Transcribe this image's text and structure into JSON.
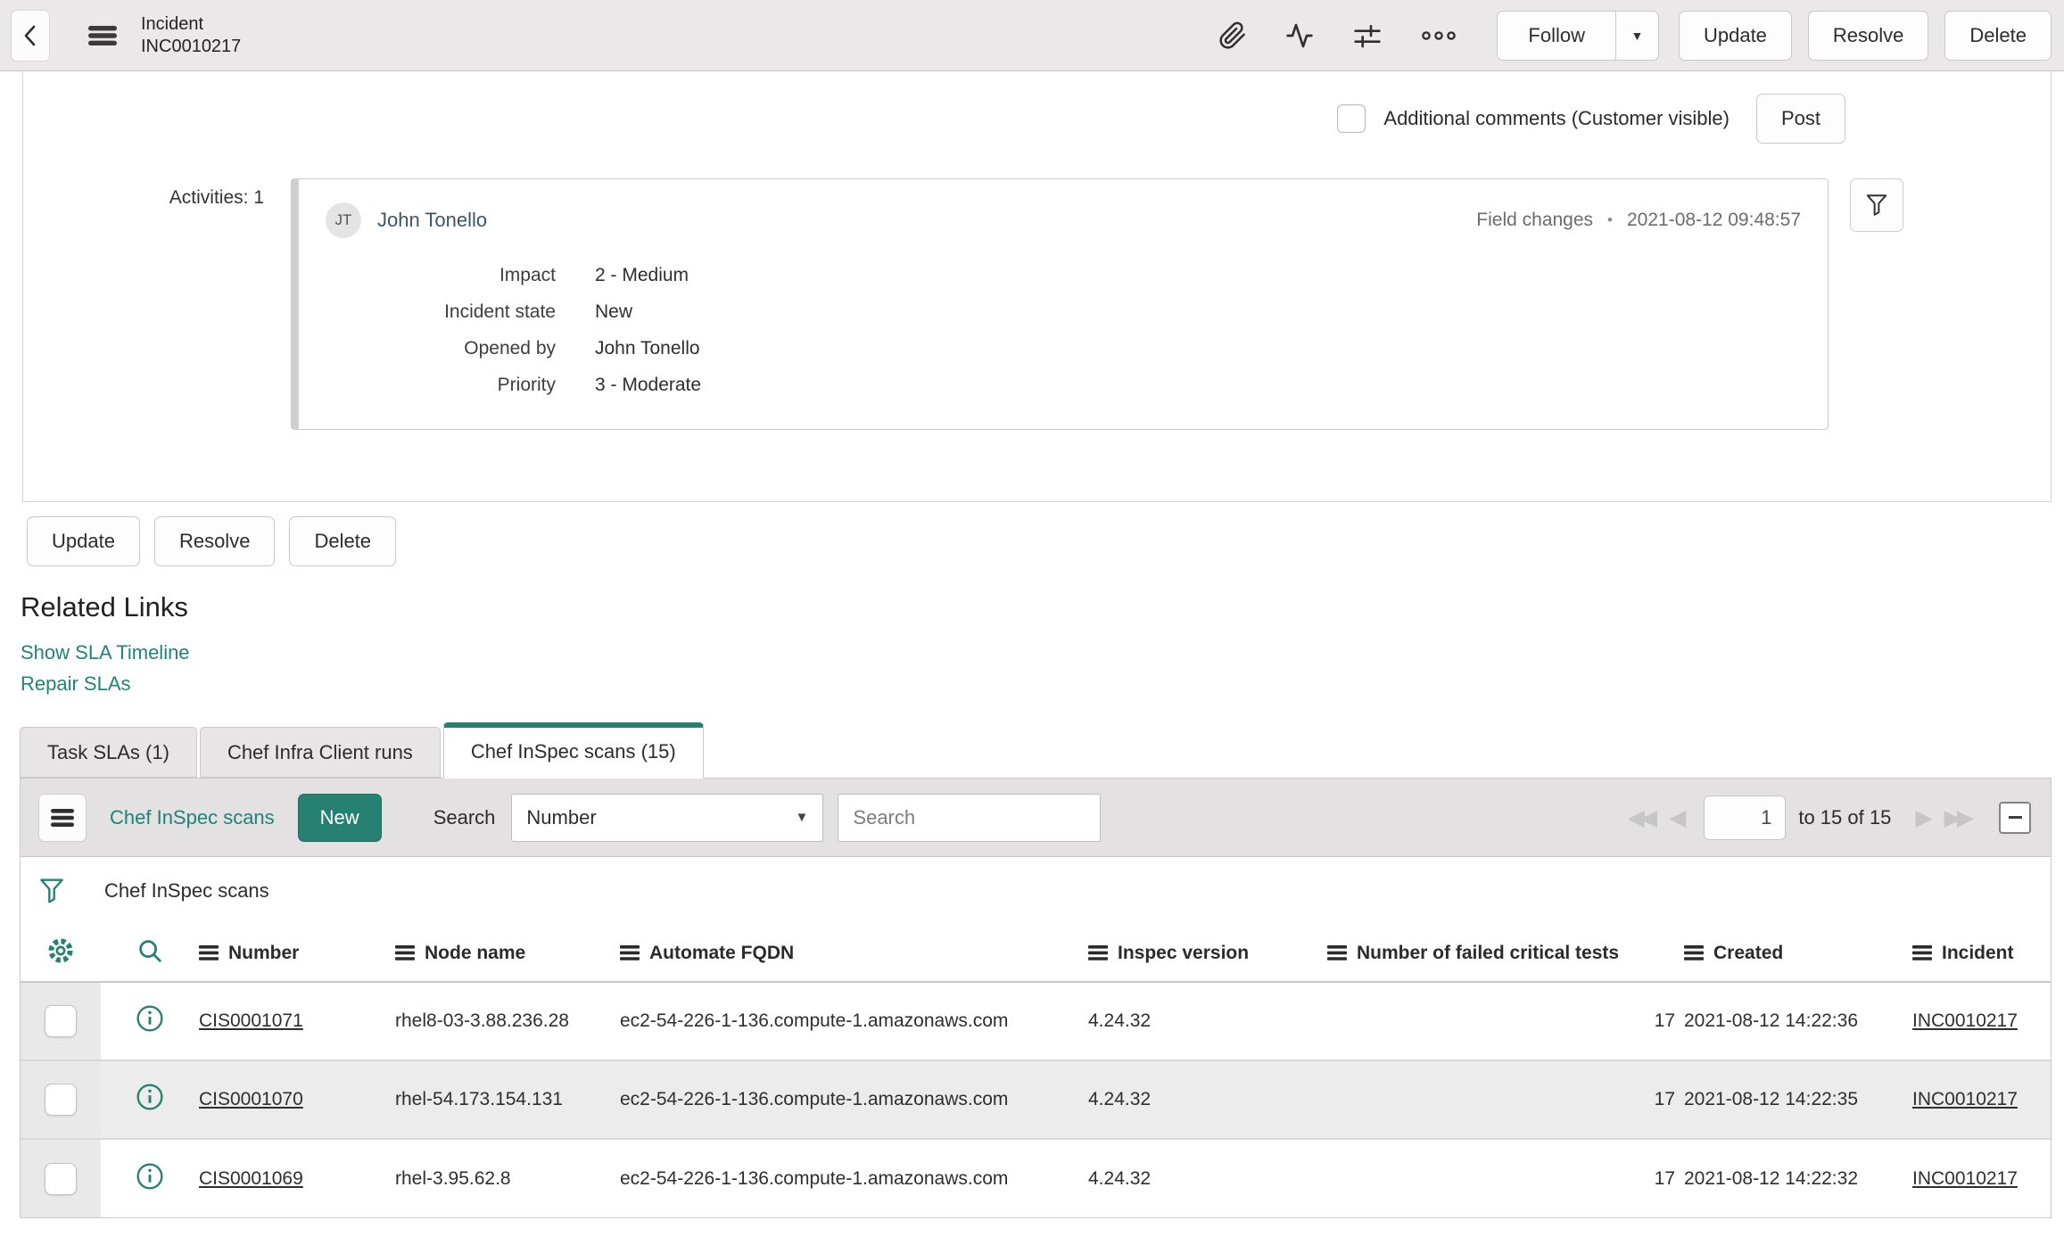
{
  "colors": {
    "accent_teal": "#278172",
    "link_teal": "#1f8476",
    "header_bg": "#eae8e8",
    "toolbar_bg": "#e3e1e1",
    "row_stripe": "#ececec"
  },
  "icons": {
    "caret_down": "▼",
    "first_page": "◀◀",
    "prev_page": "◀",
    "next_page": "▶",
    "last_page": "▶▶"
  },
  "header": {
    "title_line1": "Incident",
    "title_line2": "INC0010217"
  },
  "actions": {
    "follow": "Follow",
    "update": "Update",
    "resolve": "Resolve",
    "delete": "Delete"
  },
  "comment": {
    "checkbox_label": "Additional comments (Customer visible)",
    "post": "Post"
  },
  "activity": {
    "section_label": "Activities: 1",
    "avatar_initials": "JT",
    "user_name": "John Tonello",
    "entry_type": "Field changes",
    "separator": "•",
    "timestamp": "2021-08-12 09:48:57",
    "fields": [
      {
        "label": "Impact",
        "value": "2 - Medium"
      },
      {
        "label": "Incident state",
        "value": "New"
      },
      {
        "label": "Opened by",
        "value": "John Tonello"
      },
      {
        "label": "Priority",
        "value": "3 - Moderate"
      }
    ]
  },
  "related": {
    "title": "Related Links",
    "links": [
      {
        "label": "Show SLA Timeline"
      },
      {
        "label": "Repair SLAs"
      }
    ]
  },
  "tabs": [
    {
      "label": "Task SLAs (1)"
    },
    {
      "label": "Chef Infra Client runs"
    },
    {
      "label": "Chef InSpec scans (15)"
    }
  ],
  "list": {
    "title": "Chef InSpec scans",
    "new_label": "New",
    "search_label": "Search",
    "search_field_selected": "Number",
    "search_placeholder": "Search",
    "breadcrumb": "Chef InSpec scans",
    "pagination": {
      "current_page": "1",
      "range_text": "to 15 of 15"
    },
    "columns": [
      "Number",
      "Node name",
      "Automate FQDN",
      "Inspec version",
      "Number of failed critical tests",
      "Created",
      "Incident"
    ],
    "rows": [
      {
        "number": "CIS0001071",
        "node_name": "rhel8-03-3.88.236.28",
        "automate_fqdn": "ec2-54-226-1-136.compute-1.amazonaws.com",
        "inspec_version": "4.24.32",
        "failed_critical_tests": "17",
        "created": "2021-08-12 14:22:36",
        "incident": "INC0010217"
      },
      {
        "number": "CIS0001070",
        "node_name": "rhel-54.173.154.131",
        "automate_fqdn": "ec2-54-226-1-136.compute-1.amazonaws.com",
        "inspec_version": "4.24.32",
        "failed_critical_tests": "17",
        "created": "2021-08-12 14:22:35",
        "incident": "INC0010217"
      },
      {
        "number": "CIS0001069",
        "node_name": "rhel-3.95.62.8",
        "automate_fqdn": "ec2-54-226-1-136.compute-1.amazonaws.com",
        "inspec_version": "4.24.32",
        "failed_critical_tests": "17",
        "created": "2021-08-12 14:22:32",
        "incident": "INC0010217"
      }
    ]
  }
}
